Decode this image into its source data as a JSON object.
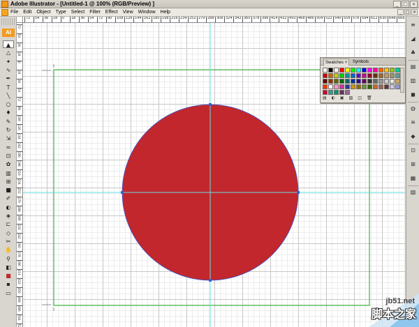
{
  "window": {
    "title": "Adobe Illustrator - [Untitled-1 @ 100% (RGB/Preview) ]",
    "controls": [
      "_",
      "□",
      "×"
    ]
  },
  "menubar": {
    "items": [
      "File",
      "Edit",
      "Object",
      "Type",
      "Select",
      "Filter",
      "Effect",
      "View",
      "Window",
      "Help"
    ],
    "doc_controls": [
      "_",
      "□",
      "×"
    ]
  },
  "toolbar": {
    "logo": "AI",
    "tools": [
      {
        "icon": "selection-arrow-icon",
        "glyph": "▲"
      },
      {
        "icon": "direct-selection-icon",
        "glyph": "△"
      },
      {
        "icon": "magic-wand-icon",
        "glyph": "✦"
      },
      {
        "icon": "lasso-icon",
        "glyph": "∿"
      },
      {
        "icon": "pen-icon",
        "glyph": "✒"
      },
      {
        "icon": "type-icon",
        "glyph": "T"
      },
      {
        "icon": "line-segment-icon",
        "glyph": "╲"
      },
      {
        "icon": "ellipse-icon",
        "glyph": "○"
      },
      {
        "icon": "paintbrush-icon",
        "glyph": "♦"
      },
      {
        "icon": "pencil-icon",
        "glyph": "✎"
      },
      {
        "icon": "rotate-icon",
        "glyph": "↻"
      },
      {
        "icon": "scale-icon",
        "glyph": "⇲"
      },
      {
        "icon": "warp-icon",
        "glyph": "≈"
      },
      {
        "icon": "free-transform-icon",
        "glyph": "⊡"
      },
      {
        "icon": "symbol-sprayer-icon",
        "glyph": "✿"
      },
      {
        "icon": "graph-icon",
        "glyph": "▥"
      },
      {
        "icon": "mesh-icon",
        "glyph": "⊞"
      },
      {
        "icon": "gradient-icon",
        "glyph": "■"
      },
      {
        "icon": "eyedropper-icon",
        "glyph": "✐"
      },
      {
        "icon": "blend-icon",
        "glyph": "◐"
      },
      {
        "icon": "live-paint-icon",
        "glyph": "◈"
      },
      {
        "icon": "crop-area-icon",
        "glyph": "⊏"
      },
      {
        "icon": "slice-icon",
        "glyph": "◇"
      },
      {
        "icon": "scissors-icon",
        "glyph": "✂"
      },
      {
        "icon": "hand-icon",
        "glyph": "✋"
      },
      {
        "icon": "zoom-icon",
        "glyph": "⚲"
      },
      {
        "icon": "default-colors-icon",
        "glyph": "◧"
      },
      {
        "icon": "fill-stroke-icon",
        "glyph": "■"
      },
      {
        "icon": "color-mode-icon",
        "glyph": "▪"
      },
      {
        "icon": "screen-mode-icon",
        "glyph": "▭"
      }
    ]
  },
  "ruler": {
    "top_labels": [
      "72",
      "54",
      "36",
      "18",
      "0",
      "18",
      "36",
      "54",
      "72",
      "90",
      "108",
      "126",
      "144",
      "162",
      "180",
      "198",
      "216",
      "234",
      "252",
      "270",
      "288",
      "306",
      "324",
      "342",
      "360",
      "378",
      "396",
      "414",
      "432",
      "450",
      "468",
      "486",
      "504",
      "522",
      "540",
      "558",
      "576",
      "594",
      "612",
      "630",
      "648",
      "666",
      "684"
    ],
    "left_labels": [
      "72",
      "54",
      "36",
      "18",
      "0",
      "18",
      "36",
      "54",
      "72",
      "90",
      "108",
      "126",
      "144",
      "162",
      "180",
      "198",
      "216",
      "234",
      "252",
      "270",
      "288",
      "306",
      "324",
      "342",
      "360",
      "378",
      "396",
      "414",
      "432",
      "450",
      "468",
      "486",
      "504",
      "522"
    ]
  },
  "artwork": {
    "circle_fill": "#c1272d",
    "circle_stroke": "#3a5bd9",
    "guide_color": "#66e0e0",
    "artboard_color": "#3fb33f"
  },
  "panel": {
    "tabs": [
      "Swatches",
      "Symbols"
    ],
    "tab_close": "×",
    "swatches": [
      "#ffffff",
      "#000000",
      "#ffffff",
      "#ff0000",
      "#ffff00",
      "#00ff00",
      "#00ffff",
      "#0000ff",
      "#ff00ff",
      "#ff0099",
      "#ff6600",
      "#ffcc00",
      "#99cc00",
      "#00cc99",
      "#cc0000",
      "#cc6600",
      "#cccc00",
      "#00cc00",
      "#009999",
      "#0066cc",
      "#6600cc",
      "#cc0099",
      "#990033",
      "#663300",
      "#996633",
      "#cc9966",
      "#999966",
      "#669999",
      "#660000",
      "#993300",
      "#666600",
      "#006600",
      "#006666",
      "#003399",
      "#330099",
      "#660066",
      "#333333",
      "#666666",
      "#999999",
      "#cccccc",
      "#e6e6e6",
      "#ccaa66",
      "#ff3300",
      "#ffffff",
      "#ff99cc",
      "#cc3399",
      "#333399",
      "#cc9900",
      "#996600",
      "#669933",
      "#336600",
      "#cc6633",
      "#996666",
      "#663333",
      "#ccccff",
      "#9999cc",
      "#cc0033",
      "#339999",
      "#009966",
      "#663366",
      "#996699"
    ],
    "bottom_icons": [
      "▤",
      "◐",
      "▣",
      "▨",
      "◫",
      "🗑"
    ]
  },
  "dock": {
    "icons": [
      "≡",
      "◢",
      "♣",
      "▤",
      "▥",
      "◼",
      "◍",
      "≋",
      "◆",
      "⊡",
      "⊞",
      "▦",
      "▧"
    ]
  },
  "watermark": {
    "url": "jb51.net",
    "brand": "脚本之家"
  }
}
